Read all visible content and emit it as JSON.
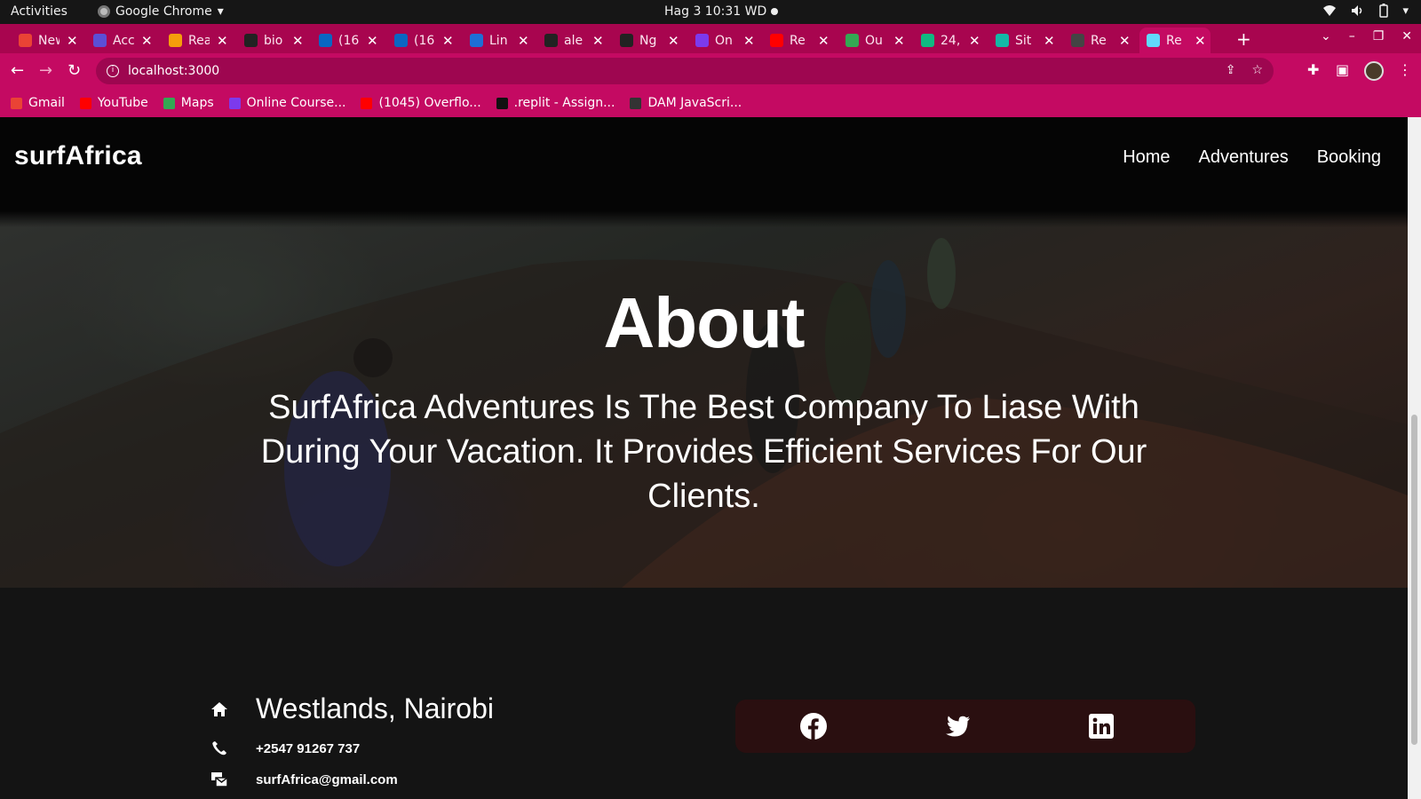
{
  "system_bar": {
    "activities": "Activities",
    "app_name": "Google Chrome",
    "clock": "Hag 3  10:31 WD"
  },
  "browser": {
    "tabs": [
      {
        "label": "New",
        "color": "#ea4335"
      },
      {
        "label": "Acc",
        "color": "#5b4fd6"
      },
      {
        "label": "Rea",
        "color": "#f59e0b"
      },
      {
        "label": "bio",
        "color": "#222222"
      },
      {
        "label": "(16",
        "color": "#0a66c2"
      },
      {
        "label": "(16",
        "color": "#0a66c2"
      },
      {
        "label": "Lin",
        "color": "#1d6fd6"
      },
      {
        "label": "ale",
        "color": "#222222"
      },
      {
        "label": "Ng",
        "color": "#222222"
      },
      {
        "label": "On",
        "color": "#7c3aed"
      },
      {
        "label": "Re",
        "color": "#ff0000"
      },
      {
        "label": "Ou",
        "color": "#34a853"
      },
      {
        "label": "24,",
        "color": "#10b981"
      },
      {
        "label": "Sit",
        "color": "#14b8a6"
      },
      {
        "label": "Re",
        "color": "#444444"
      },
      {
        "label": "Re",
        "color": "#61dafb"
      }
    ],
    "address": "localhost:3000",
    "bookmarks": [
      {
        "label": "Gmail",
        "color": "#ea4335"
      },
      {
        "label": "YouTube",
        "color": "#ff0000"
      },
      {
        "label": "Maps",
        "color": "#34a853"
      },
      {
        "label": "Online Course...",
        "color": "#7c3aed"
      },
      {
        "label": "(1045) Overflo...",
        "color": "#ff0000"
      },
      {
        "label": ".replit - Assign...",
        "color": "#111111"
      },
      {
        "label": "DAM JavaScri...",
        "color": "#333333"
      }
    ]
  },
  "site": {
    "logo": "surfAfrica",
    "nav": [
      {
        "label": "Home"
      },
      {
        "label": "Adventures"
      },
      {
        "label": "Booking"
      }
    ],
    "hero": {
      "title": "About",
      "text": "SurfAfrica Adventures Is The Best Company To Liase With During Your Vacation. It Provides Efficient Services For Our Clients."
    },
    "contact": {
      "address": "Westlands, Nairobi",
      "phone": "+2547 91267 737",
      "email": "surfAfrica@gmail.com"
    },
    "social_icons": [
      "facebook-icon",
      "twitter-icon",
      "linkedin-icon"
    ]
  },
  "colors": {
    "tab_strip": "#a8054f",
    "toolbar": "#c40a62",
    "site_nav": "#050505",
    "footer": "#141414",
    "social_box": "#2a0f10"
  }
}
